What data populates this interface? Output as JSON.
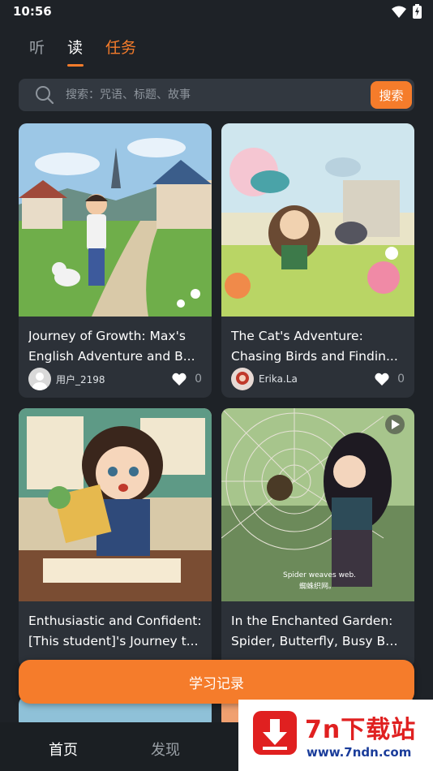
{
  "status_bar": {
    "time": "10:56"
  },
  "top_tabs": [
    {
      "label": "听"
    },
    {
      "label": "读"
    },
    {
      "label": "任务"
    }
  ],
  "search": {
    "placeholder": "搜索：咒语、标题、故事",
    "button_label": "搜索"
  },
  "cards": [
    {
      "title_line1": "Journey of Growth: Max's",
      "title_line2": "English Adventure and B...",
      "author": "用户_2198",
      "likes": "0"
    },
    {
      "title_line1": "The Cat's Adventure:",
      "title_line2": "Chasing Birds and Findin...",
      "author": "Erika.La",
      "likes": "0"
    },
    {
      "title_line1": "Enthusiastic and Confident:",
      "title_line2": "[This student]'s Journey t...",
      "author": "",
      "likes": ""
    },
    {
      "title_line1": "In the Enchanted Garden:",
      "title_line2": "Spider, Butterfly, Busy Be...",
      "author": "",
      "likes": "",
      "image_caption_line1": "Spider weaves web.",
      "image_caption_line2": "蜘蛛织网。"
    }
  ],
  "record_button": {
    "label": "学习记录"
  },
  "bottom_nav": [
    {
      "label": "首页"
    },
    {
      "label": "发现"
    }
  ],
  "watermark": {
    "brand": "7n下载站",
    "url": "www.7ndn.com"
  },
  "colors": {
    "accent": "#f57c2b",
    "background": "#1e2227",
    "card": "#2c3138"
  }
}
